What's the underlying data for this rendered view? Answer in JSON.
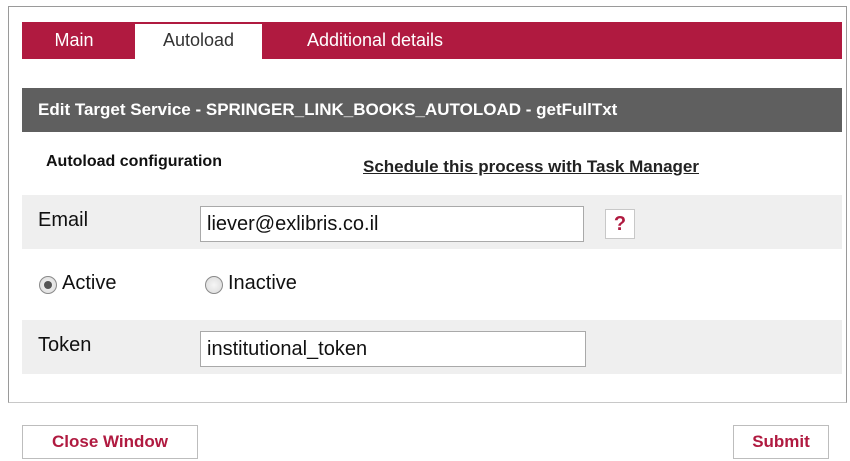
{
  "tabs": [
    {
      "label": "Main",
      "active": false
    },
    {
      "label": "Autoload",
      "active": true
    },
    {
      "label": "Additional details",
      "active": false
    }
  ],
  "title": "Edit Target Service - SPRINGER_LINK_BOOKS_AUTOLOAD - getFullTxt",
  "section": {
    "label": "Autoload configuration",
    "schedule_link": "Schedule this process with Task Manager"
  },
  "email": {
    "label": "Email",
    "value": "liever@exlibris.co.il",
    "help_label": "?"
  },
  "status": {
    "options": [
      {
        "label": "Active",
        "checked": true
      },
      {
        "label": "Inactive",
        "checked": false
      }
    ]
  },
  "token": {
    "label": "Token",
    "value": "institutional_token"
  },
  "buttons": {
    "close": "Close Window",
    "submit": "Submit"
  },
  "colors": {
    "accent": "#b01a40",
    "title_bar": "#5f5f5f",
    "row_shade": "#efefef"
  },
  "icons": {
    "help": "question-mark-icon",
    "radio": "radio-button-icon"
  }
}
